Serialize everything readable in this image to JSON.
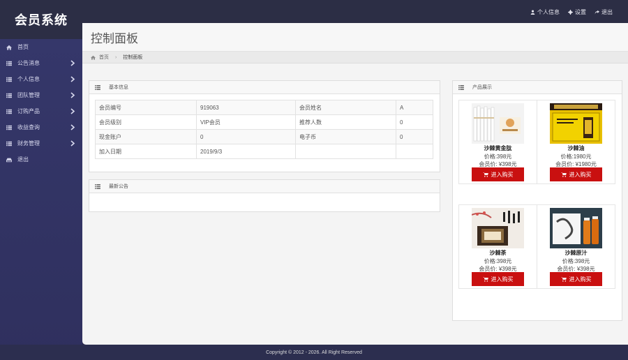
{
  "brand": "会员系统",
  "top_links": [
    {
      "label": "个人信息",
      "icon": "user-icon"
    },
    {
      "label": "设置",
      "icon": "gear-icon"
    },
    {
      "label": "退出",
      "icon": "share-icon"
    }
  ],
  "sidebar": {
    "items": [
      {
        "label": "首页",
        "icon": "home-icon",
        "has_children": false
      },
      {
        "label": "公告消息",
        "icon": "list-icon",
        "has_children": true
      },
      {
        "label": "个人信息",
        "icon": "list-icon",
        "has_children": true
      },
      {
        "label": "团队管理",
        "icon": "list-icon",
        "has_children": true
      },
      {
        "label": "订购产品",
        "icon": "list-icon",
        "has_children": true
      },
      {
        "label": "收益查询",
        "icon": "list-icon",
        "has_children": true
      },
      {
        "label": "财务管理",
        "icon": "list-icon",
        "has_children": true
      },
      {
        "label": "退出",
        "icon": "hdd-icon",
        "has_children": false
      }
    ]
  },
  "page": {
    "title": "控制面板",
    "breadcrumb": {
      "home": "首页",
      "current": "控制面板"
    }
  },
  "basic_info": {
    "title": "基本信息",
    "rows": [
      [
        "会员编号",
        "919063",
        "会员姓名",
        "A"
      ],
      [
        "会员级别",
        "VIP会员",
        "推荐人数",
        "0"
      ],
      [
        "现金账户",
        "0",
        "电子币",
        "0"
      ],
      [
        "加入日期",
        "2019/9/3",
        "",
        ""
      ]
    ]
  },
  "announcements": {
    "title": "最新公告"
  },
  "products": {
    "title": "产品展示",
    "buy_label": "进入购买",
    "items": [
      {
        "name": "沙棘黄金肽",
        "price": "价格:398元",
        "member_price": "会员价: ¥398元"
      },
      {
        "name": "沙棘油",
        "price": "价格:1980元",
        "member_price": "会员价: ¥1980元"
      },
      {
        "name": "沙棘茶",
        "price": "价格:398元",
        "member_price": "会员价: ¥398元"
      },
      {
        "name": "沙棘原汁",
        "price": "价格:398元",
        "member_price": "会员价: ¥398元"
      }
    ]
  },
  "footer": "Copyright © 2012 - 2026. All Right Reserved",
  "colors": {
    "sidebar": "#333366",
    "topbar": "#2c2e45",
    "buy_button": "#c91010"
  }
}
